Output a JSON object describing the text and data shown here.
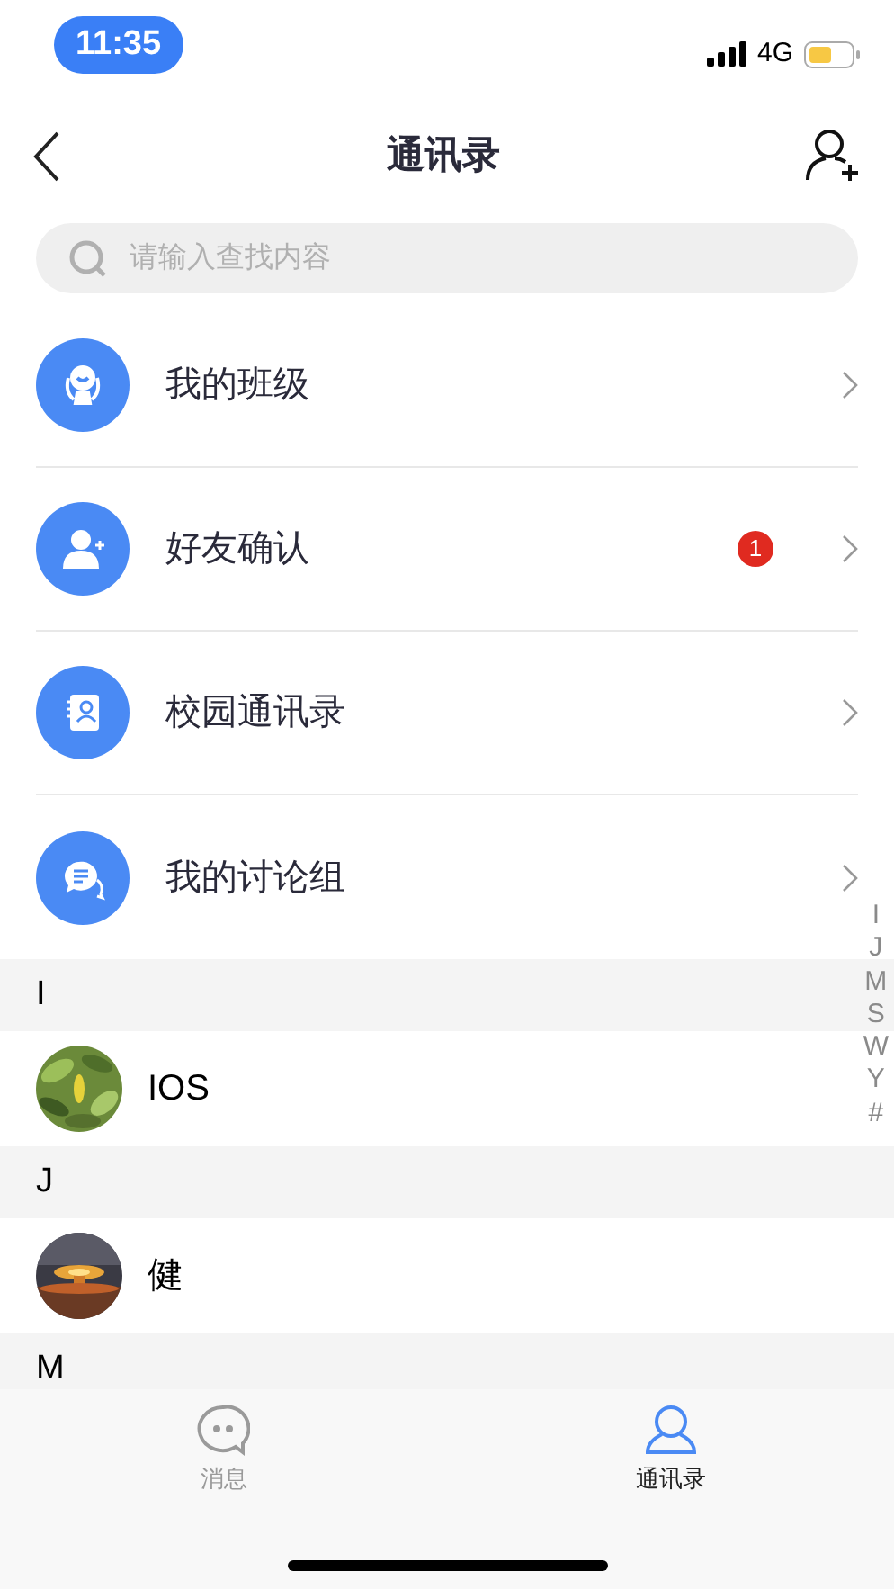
{
  "status_bar": {
    "time": "11:35",
    "network": "4G"
  },
  "nav": {
    "title": "通讯录"
  },
  "search": {
    "placeholder": "请输入查找内容"
  },
  "menu": [
    {
      "kind": "class",
      "label": "我的班级"
    },
    {
      "kind": "friend",
      "label": "好友确认",
      "badge": "1"
    },
    {
      "kind": "campus",
      "label": "校园通讯录"
    },
    {
      "kind": "group",
      "label": "我的讨论组"
    }
  ],
  "sections": [
    {
      "letter": "I",
      "contacts": [
        {
          "name": "IOS"
        }
      ]
    },
    {
      "letter": "J",
      "contacts": [
        {
          "name": "健"
        }
      ]
    },
    {
      "letter": "M"
    }
  ],
  "index": [
    "I",
    "J",
    "M",
    "S",
    "W",
    "Y",
    "#"
  ],
  "tabs": [
    {
      "kind": "chat",
      "label": "消息",
      "selected": false
    },
    {
      "kind": "contacts",
      "label": "通讯录",
      "selected": true
    }
  ]
}
